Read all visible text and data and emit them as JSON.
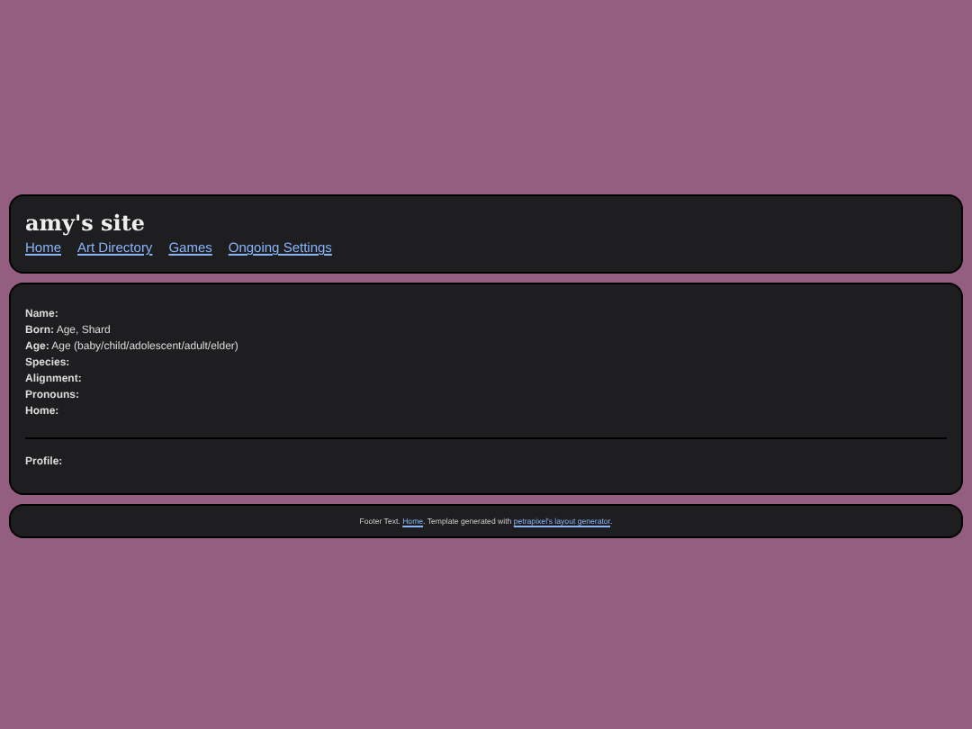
{
  "header": {
    "title": "amy's site",
    "nav": [
      {
        "label": "Home"
      },
      {
        "label": "Art Directory"
      },
      {
        "label": "Games"
      },
      {
        "label": "Ongoing Settings"
      }
    ]
  },
  "profile": {
    "fields": [
      "**Name:**",
      "**Born:** Age, Shard",
      "**Age:** Age (baby/child/adolescent/adult/elder)",
      "**Species:**",
      "**Alignment:**",
      "**Pronouns:**",
      "**Home:**"
    ],
    "sections": [
      "**Profile:**"
    ]
  },
  "footer": [
    {
      "kind": "text",
      "text": "Footer Text."
    },
    {
      "kind": "link",
      "text": "Home"
    },
    {
      "kind": "text",
      "text": ". Template generated with"
    },
    {
      "kind": "link",
      "text": "petrapixel's layout generator"
    },
    {
      "kind": "text",
      "text": "."
    }
  ]
}
